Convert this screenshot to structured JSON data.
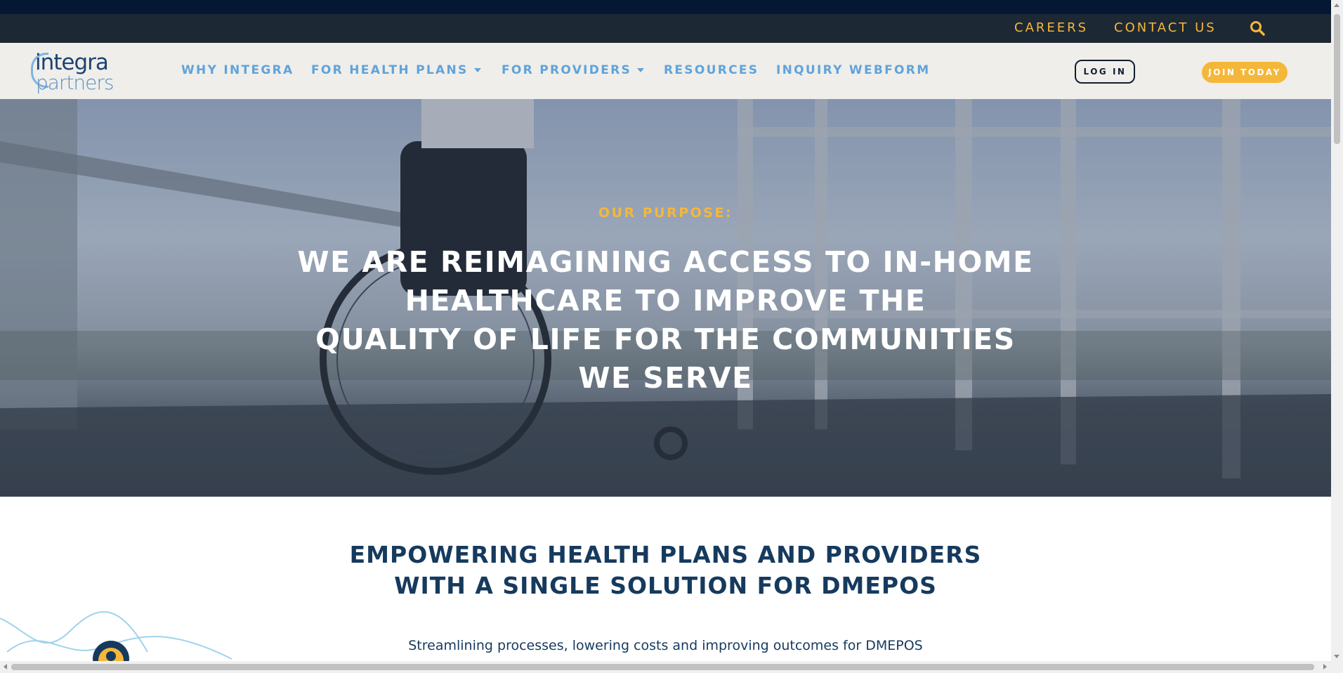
{
  "utility_nav": {
    "careers": "CAREERS",
    "contact_us": "CONTACT US",
    "search_icon": "search-icon"
  },
  "brand": {
    "line1": "integra",
    "line2": "partners"
  },
  "main_nav": {
    "items": [
      {
        "label": "WHY INTEGRA",
        "has_dropdown": false
      },
      {
        "label": "FOR HEALTH PLANS",
        "has_dropdown": true
      },
      {
        "label": "FOR PROVIDERS",
        "has_dropdown": true
      },
      {
        "label": "RESOURCES",
        "has_dropdown": false
      },
      {
        "label": "INQUIRY WEBFORM",
        "has_dropdown": false
      }
    ],
    "login_label": "LOG IN",
    "join_label": "JOIN TODAY"
  },
  "hero": {
    "tagline": "OUR PURPOSE:",
    "headline_lines": [
      "WE ARE REIMAGINING ACCESS TO IN-HOME",
      "HEALTHCARE TO IMPROVE THE",
      "QUALITY OF LIFE FOR THE COMMUNITIES",
      "WE SERVE"
    ]
  },
  "section": {
    "title_lines": [
      "EMPOWERING HEALTH PLANS AND PROVIDERS",
      "WITH A SINGLE SOLUTION FOR DMEPOS"
    ],
    "subtitle": "Streamlining processes, lowering costs and improving outcomes for DMEPOS"
  },
  "colors": {
    "accent_gold": "#f5b73a",
    "nav_blue": "#5fa3db",
    "dark_navy": "#163a5e",
    "utility_bar": "#1d2835",
    "top_strip": "#051732",
    "nav_bg": "#efeeea"
  }
}
